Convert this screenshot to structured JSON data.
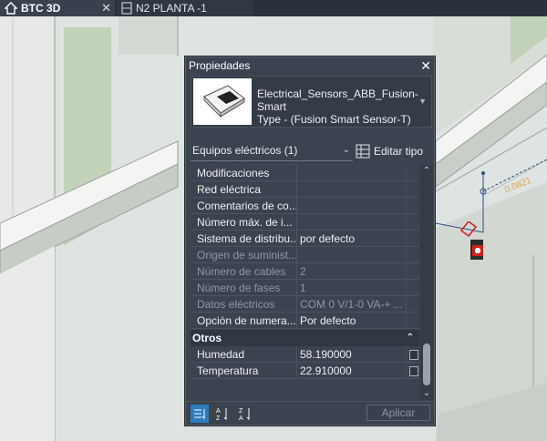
{
  "tabs": [
    {
      "label": "BTC 3D",
      "active": true
    },
    {
      "label": "N2 PLANTA -1",
      "active": false
    }
  ],
  "viewport": {
    "dimension_label": "0.0821"
  },
  "palette": {
    "title": "Propiedades",
    "type_selector": {
      "line1": "Electrical_Sensors_ABB_Fusion-Smart",
      "line2": "Type - (Fusion Smart Sensor-T)"
    },
    "category_filter": "Equipos eléctricos (1)",
    "edit_type_label": "Editar tipo",
    "rows": [
      {
        "name": "Modificaciones",
        "value": "",
        "disabled": false
      },
      {
        "name": "Red eléctrica",
        "value": "",
        "disabled": false
      },
      {
        "name": "Comentarios de co...",
        "value": "",
        "disabled": false
      },
      {
        "name": "Número máx. de i...",
        "value": "",
        "disabled": false
      },
      {
        "name": "Sistema de distribu...",
        "value": "por defecto",
        "disabled": false
      },
      {
        "name": "Origen de suminist...",
        "value": "",
        "disabled": true
      },
      {
        "name": "Número de cables",
        "value": "2",
        "disabled": true
      },
      {
        "name": "Número de fases",
        "value": "1",
        "disabled": true
      },
      {
        "name": "Datos eléctricos",
        "value": "COM 0 V/1-0 VA-+ ...",
        "disabled": true
      },
      {
        "name": "Opción de numera...",
        "value": "Por defecto",
        "disabled": false
      }
    ],
    "group_otros": "Otros",
    "other_rows": [
      {
        "name": "Humedad",
        "value": "58.190000"
      },
      {
        "name": "Temperatura",
        "value": "22.910000"
      }
    ],
    "apply_label": "Aplicar"
  },
  "colors": {
    "accent": "#2f7bbf",
    "panel_bg": "#3b444c",
    "tab_bg": "#2a3138",
    "sensor_red": "#cc1f1f"
  }
}
